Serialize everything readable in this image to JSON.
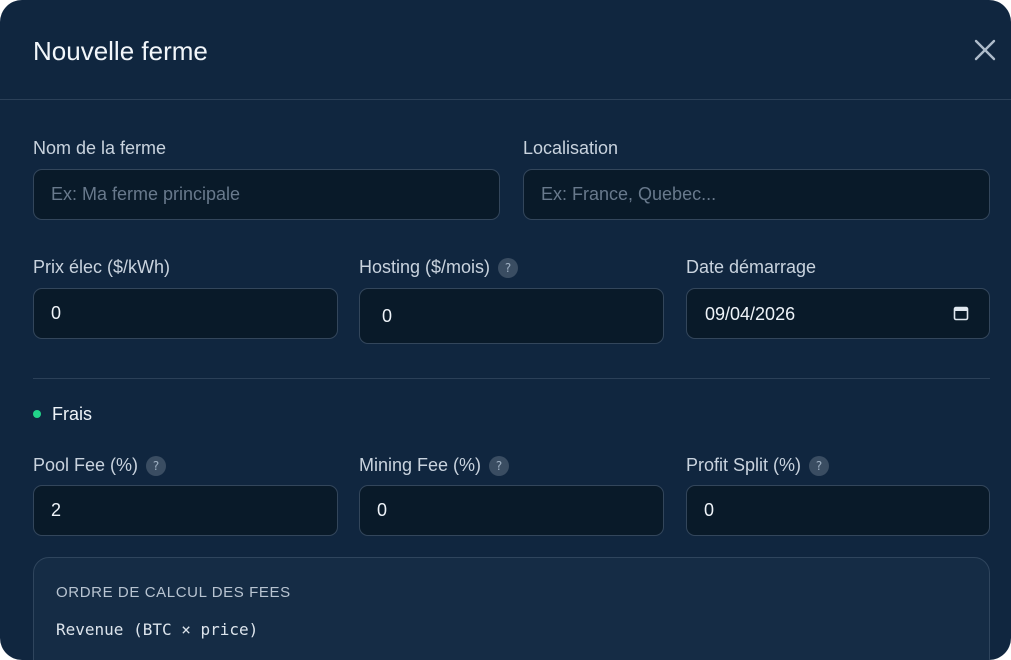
{
  "modal": {
    "title": "Nouvelle ferme"
  },
  "fields": {
    "name": {
      "label": "Nom de la ferme",
      "placeholder": "Ex: Ma ferme principale",
      "value": ""
    },
    "location": {
      "label": "Localisation",
      "placeholder": "Ex: France, Quebec...",
      "value": ""
    },
    "elec_price": {
      "label": "Prix élec ($/kWh)",
      "value": "0"
    },
    "hosting": {
      "label": "Hosting ($/mois)",
      "value": "0",
      "help": "?"
    },
    "start_date": {
      "label": "Date démarrage",
      "value": "09/04/2026"
    },
    "pool_fee": {
      "label": "Pool Fee (%)",
      "value": "2",
      "help": "?"
    },
    "mining_fee": {
      "label": "Mining Fee (%)",
      "value": "0",
      "help": "?"
    },
    "profit_split": {
      "label": "Profit Split (%)",
      "value": "0",
      "help": "?"
    }
  },
  "fees_section": {
    "label": "Frais",
    "dot_color": "#22d48a"
  },
  "calc_box": {
    "title": "ORDRE DE CALCUL DES FEES",
    "line1": "Revenue (BTC × price)"
  },
  "icons": {
    "close": "close-icon",
    "help": "help-icon",
    "calendar": "calendar-icon"
  },
  "colors": {
    "modal_bg": "#10263f",
    "input_bg": "#091a29",
    "accent_green": "#22d48a"
  }
}
